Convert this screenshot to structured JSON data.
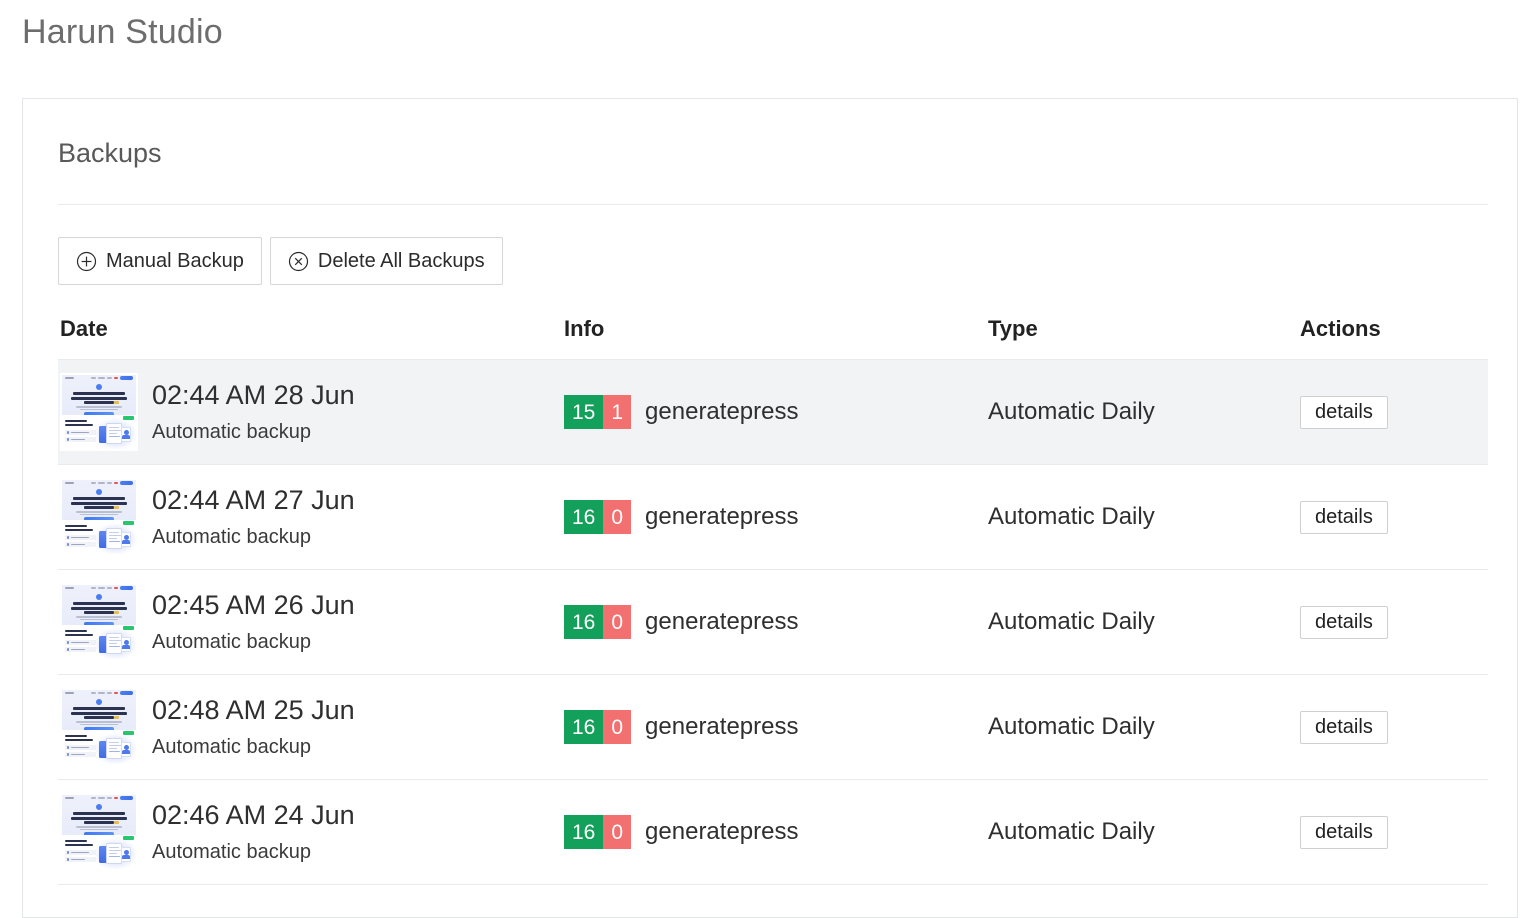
{
  "page": {
    "title": "Harun Studio"
  },
  "card": {
    "title": "Backups"
  },
  "toolbar": {
    "manual_backup_label": "Manual Backup",
    "manual_backup_icon": "circle-plus-icon",
    "delete_all_label": "Delete All Backups",
    "delete_all_icon": "circle-x-icon"
  },
  "table": {
    "headers": {
      "date": "Date",
      "info": "Info",
      "type": "Type",
      "actions": "Actions"
    },
    "action_label": "details",
    "rows": [
      {
        "date": "02:44 AM 28 Jun",
        "subtitle": "Automatic backup",
        "ok_count": "15",
        "error_count": "1",
        "info_label": "generatepress",
        "type": "Automatic Daily",
        "action": "details",
        "highlighted": true
      },
      {
        "date": "02:44 AM 27 Jun",
        "subtitle": "Automatic backup",
        "ok_count": "16",
        "error_count": "0",
        "info_label": "generatepress",
        "type": "Automatic Daily",
        "action": "details",
        "highlighted": false
      },
      {
        "date": "02:45 AM 26 Jun",
        "subtitle": "Automatic backup",
        "ok_count": "16",
        "error_count": "0",
        "info_label": "generatepress",
        "type": "Automatic Daily",
        "action": "details",
        "highlighted": false
      },
      {
        "date": "02:48 AM 25 Jun",
        "subtitle": "Automatic backup",
        "ok_count": "16",
        "error_count": "0",
        "info_label": "generatepress",
        "type": "Automatic Daily",
        "action": "details",
        "highlighted": false
      },
      {
        "date": "02:46 AM 24 Jun",
        "subtitle": "Automatic backup",
        "ok_count": "16",
        "error_count": "0",
        "info_label": "generatepress",
        "type": "Automatic Daily",
        "action": "details",
        "highlighted": false
      }
    ]
  },
  "colors": {
    "badge_ok": "#13a05a",
    "badge_error": "#f2706f",
    "row_highlight": "#f2f3f4",
    "border": "#e3e5e8",
    "title_text": "#6d6d6d"
  }
}
